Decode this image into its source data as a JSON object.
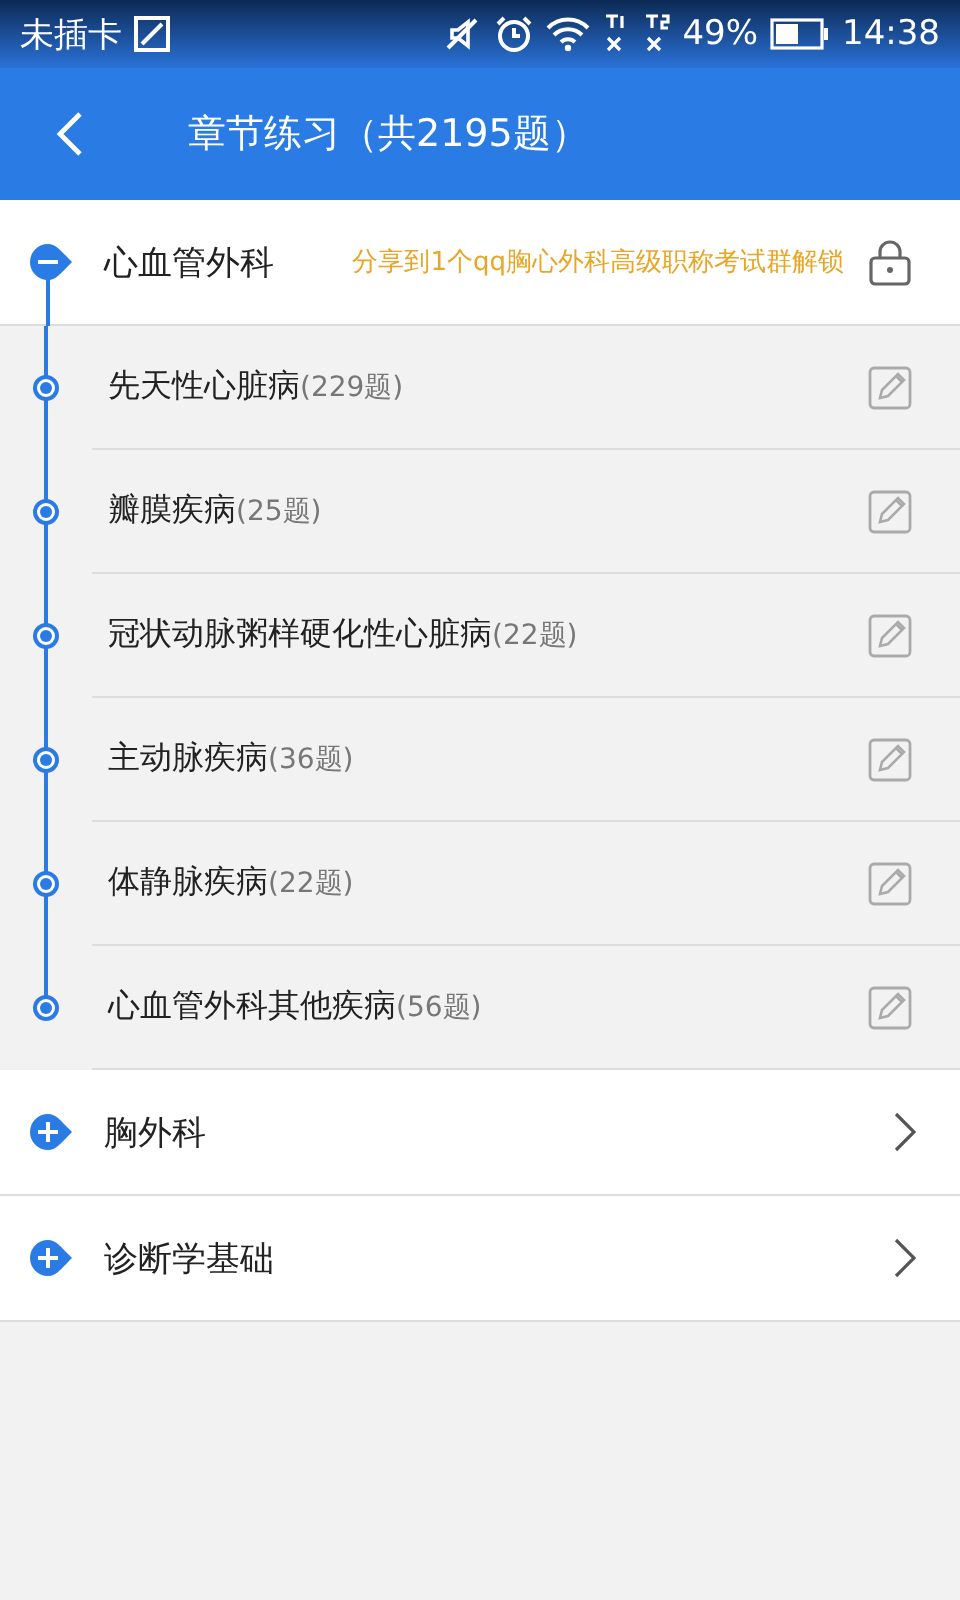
{
  "status_bar": {
    "carrier": "未插卡",
    "battery": "49%",
    "time": "14:38"
  },
  "header": {
    "title": "章节练习（共2195题）"
  },
  "sections": [
    {
      "title": "心血管外科",
      "expanded": true,
      "lock_hint": "分享到1个qq胸心外科高级职称考试群解锁",
      "children": [
        {
          "name": "先天性心脏病",
          "count": "(229题)"
        },
        {
          "name": "瓣膜疾病",
          "count": "(25题)"
        },
        {
          "name": "冠状动脉粥样硬化性心脏病",
          "count": "(22题)"
        },
        {
          "name": "主动脉疾病",
          "count": "(36题)"
        },
        {
          "name": "体静脉疾病",
          "count": "(22题)"
        },
        {
          "name": "心血管外科其他疾病",
          "count": "(56题)"
        }
      ]
    },
    {
      "title": "胸外科",
      "expanded": false
    },
    {
      "title": "诊断学基础",
      "expanded": false
    }
  ]
}
